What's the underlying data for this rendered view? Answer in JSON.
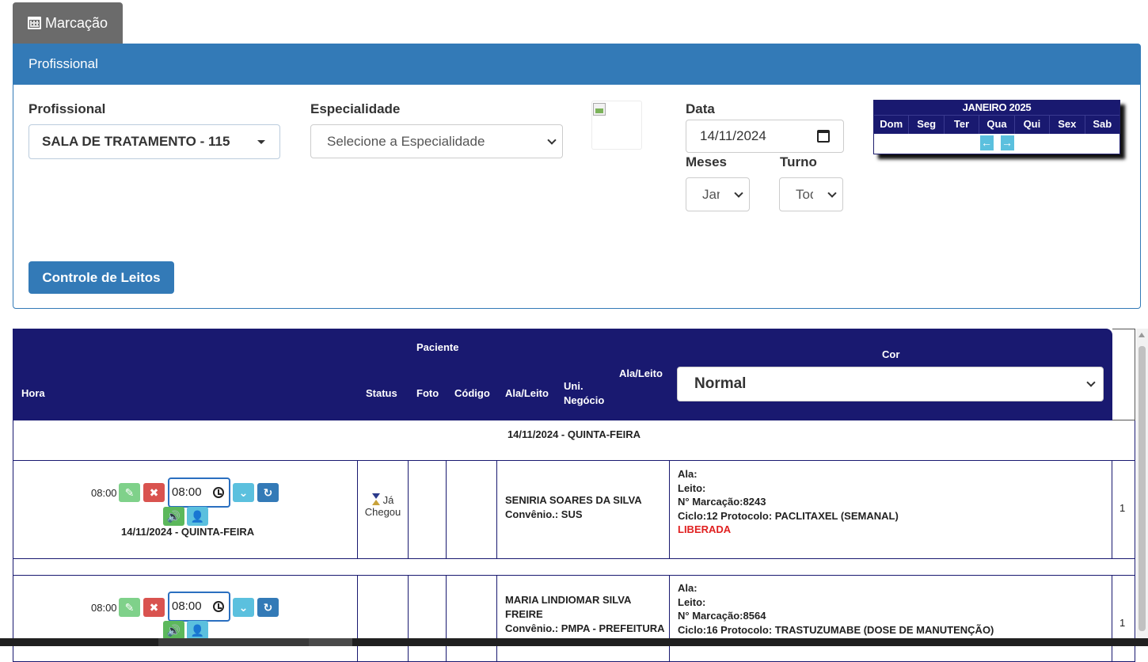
{
  "tab": {
    "label": "Marcação",
    "icon": "calendar-icon"
  },
  "panel": {
    "title": "Profissional",
    "profissional_label": "Profissional",
    "profissional_value": "SALA DE TRATAMENTO - 115",
    "especialidade_label": "Especialidade",
    "especialidade_value": "Selecione a Especialidade",
    "data_label": "Data",
    "data_value": "14/11/2024",
    "meses_label": "Meses",
    "meses_value": "Jan",
    "turno_label": "Turno",
    "turno_value": "Tod",
    "button_leitos": "Controle de Leitos"
  },
  "mini_calendar": {
    "title": "JANEIRO 2025",
    "days": [
      "Dom",
      "Seg",
      "Ter",
      "Qua",
      "Qui",
      "Sex",
      "Sab"
    ],
    "prev": "🡄",
    "next": "🡆"
  },
  "table": {
    "headers": {
      "paciente": "Paciente",
      "hora": "Hora",
      "status": "Status",
      "foto": "Foto",
      "codigo": "Código",
      "ala_leito": "Ala/Leito",
      "uni_negocio_1": "Uni.",
      "uni_negocio_2": "Negócio",
      "ala_leito_2": "Ala/Leito",
      "cor": "Cor",
      "cor_value": "Normal"
    },
    "day_header": "14/11/2024 - QUINTA-FEIRA",
    "rows": [
      {
        "hora": "08:00",
        "time_value": "08:00",
        "date": "14/11/2024 - QUINTA-FEIRA",
        "status": "Já Chegou",
        "status_line1": "Já",
        "status_line2": "Chegou",
        "paciente_nome_1": "SENIRIA SOARES DA SILVA",
        "paciente_nome_2": "",
        "convenio": "Convênio.: SUS",
        "ala": "Ala:",
        "leito": "Leito:",
        "marcacao": "N° Marcação:8243",
        "ciclo": "Ciclo:12 Protocolo: PACLITAXEL (SEMANAL)",
        "situacao": "LIBERADA",
        "num": "1"
      },
      {
        "hora": "08:00",
        "time_value": "08:00",
        "paciente_nome_1": "MARIA LINDIOMAR SILVA",
        "paciente_nome_2": "FREIRE",
        "convenio": "Convênio.: PMPA - PREFEITURA",
        "ala": "Ala:",
        "leito": "Leito:",
        "marcacao": "N° Marcação:8564",
        "ciclo": "Ciclo:16 Protocolo: TRASTUZUMABE (DOSE DE MANUTENÇÃO)",
        "num": "1"
      }
    ]
  },
  "colors": {
    "primary": "#337ab7",
    "header_navy": "#191970",
    "danger": "#d9534f",
    "success": "#5cb85c",
    "info": "#5bc0de",
    "liberada": "#e02020"
  }
}
